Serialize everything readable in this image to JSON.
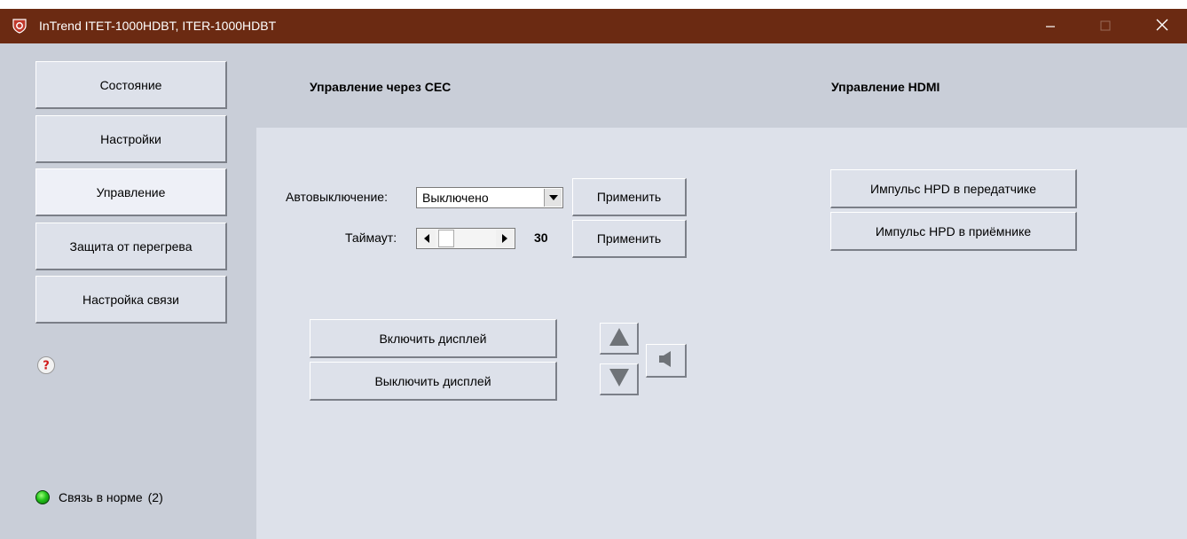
{
  "window": {
    "title": "InTrend ITET-1000HDBT, ITER-1000HDBT",
    "icon": "shield-app-icon",
    "minimize_icon": "minimize-icon",
    "maximize_icon": "maximize-icon",
    "close_icon": "close-icon"
  },
  "sidebar": {
    "items": [
      {
        "label": "Состояние"
      },
      {
        "label": "Настройки"
      },
      {
        "label": "Управление"
      },
      {
        "label": "Защита от перегрева"
      },
      {
        "label": "Настройка связи"
      }
    ],
    "active": "Управление",
    "help_icon": "help-icon"
  },
  "status": {
    "text": "Связь в норме",
    "count": "(2)",
    "indicator_color": "#22c21a"
  },
  "cec": {
    "heading": "Управление через СЕС",
    "auto_off_label": "Автовыключение:",
    "auto_off_value": "Выключено",
    "timeout_label": "Таймаут:",
    "timeout_value": "30",
    "apply_label": "Применить",
    "display_on_label": "Включить дисплей",
    "display_off_label": "Выключить дисплей",
    "vol_up_icon": "triangle-up-icon",
    "vol_down_icon": "triangle-down-icon",
    "mute_icon": "speaker-mute-icon"
  },
  "hdmi": {
    "heading": "Управление HDMI",
    "hpd_tx_label": "Импульс HPD в передатчике",
    "hpd_rx_label": "Импульс HPD в приёмнике"
  },
  "colors": {
    "titlebar": "#6b2a12",
    "panel": "#dde1ea",
    "background": "#c9ced8"
  }
}
